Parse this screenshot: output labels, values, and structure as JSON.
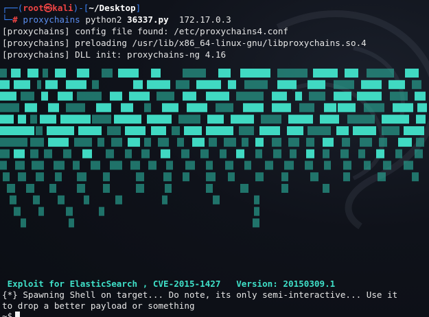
{
  "prompt": {
    "corner_top": "┌──(",
    "user": "root",
    "at_symbol": "㉿",
    "host": "kali",
    "separator": ")-[",
    "path": "~/Desktop",
    "close": "]",
    "corner_bottom": "└─",
    "hash": "#",
    "command_tool": "proxychains",
    "command_interp": "python2",
    "command_script": "36337.py",
    "command_target": "172.17.0.3"
  },
  "output": {
    "line1": "[proxychains] config file found: /etc/proxychains4.conf",
    "line2": "[proxychains] preloading /usr/lib/x86_64-linux-gnu/libproxychains.so.4",
    "line3": "[proxychains] DLL init: proxychains-ng 4.16"
  },
  "banner": {
    "exploit_title": " Exploit for ElasticSearch , CVE-2015-1427   Version: 20150309.1"
  },
  "messages": {
    "spawning": "{*} Spawning Shell on target... Do note, its only semi-interactive... Use it",
    "spawning_cont": "to drop a better payload or something"
  },
  "input": {
    "prompt_symbol": "~$"
  },
  "colors": {
    "banner_teal": "#40d9c2",
    "prompt_blue": "#3b82f6",
    "prompt_red": "#ef4444"
  }
}
